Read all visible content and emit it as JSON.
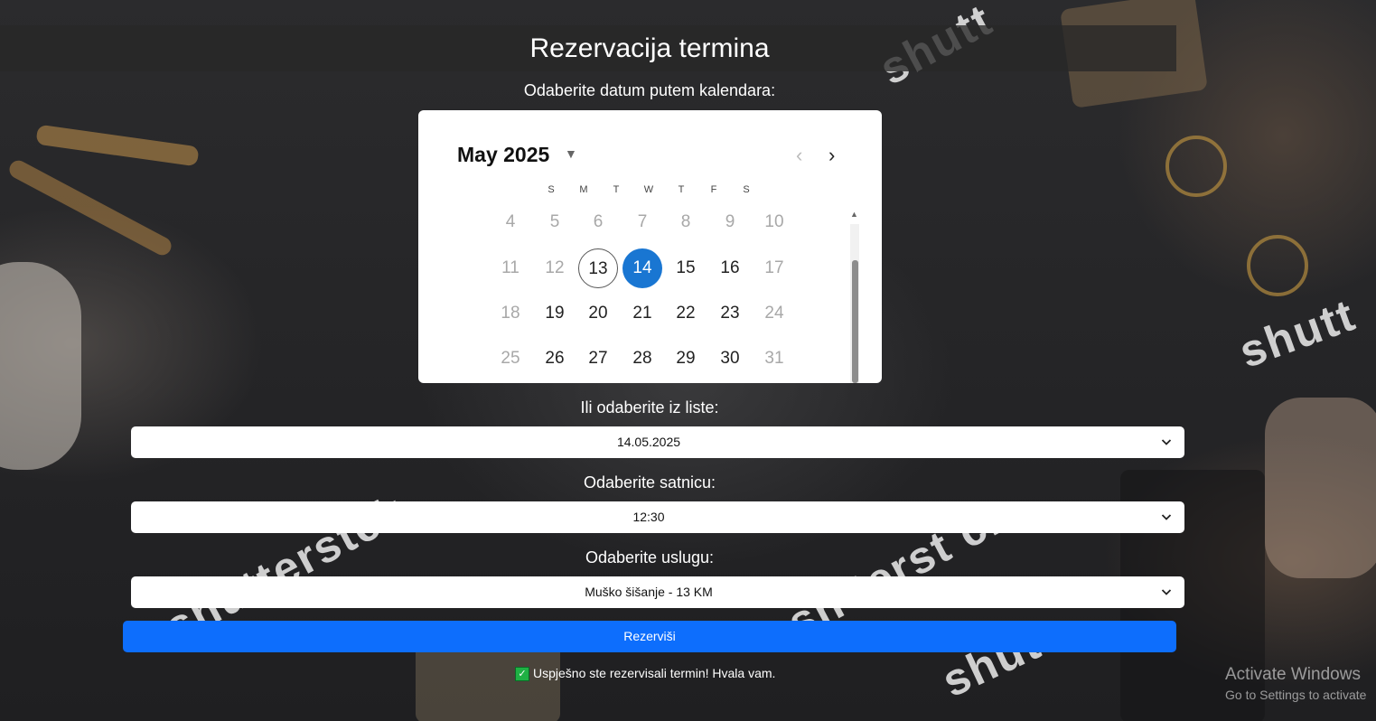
{
  "page": {
    "title": "Rezervacija termina"
  },
  "calendar": {
    "label": "Odaberite datum putem kalendara:",
    "month_label": "May 2025",
    "weekdays": [
      "S",
      "M",
      "T",
      "W",
      "T",
      "F",
      "S"
    ],
    "rows": [
      [
        "4",
        "5",
        "6",
        "7",
        "8",
        "9",
        "10"
      ],
      [
        "11",
        "12",
        "13",
        "14",
        "15",
        "16",
        "17"
      ],
      [
        "18",
        "19",
        "20",
        "21",
        "22",
        "23",
        "24"
      ],
      [
        "25",
        "26",
        "27",
        "28",
        "29",
        "30",
        "31"
      ]
    ],
    "today": "13",
    "selected": "14",
    "disabled_days": [
      "4",
      "5",
      "6",
      "7",
      "8",
      "9",
      "10",
      "11",
      "12",
      "17",
      "18",
      "24",
      "25",
      "31"
    ]
  },
  "date_list": {
    "label": "Ili odaberite iz liste:",
    "value": "14.05.2025"
  },
  "time": {
    "label": "Odaberite satnicu:",
    "value": "12:30"
  },
  "service": {
    "label": "Odaberite uslugu:",
    "value": "Muško šišanje - 13 KM"
  },
  "submit": {
    "label": "Rezerviši"
  },
  "status": {
    "message": "Uspješno ste rezervisali termin! Hvala vam."
  },
  "watermark": {
    "activate_title": "Activate Windows",
    "activate_sub": "Go to Settings to activate"
  },
  "colors": {
    "primary": "#0d6efd",
    "selected_day": "#1976d2"
  }
}
